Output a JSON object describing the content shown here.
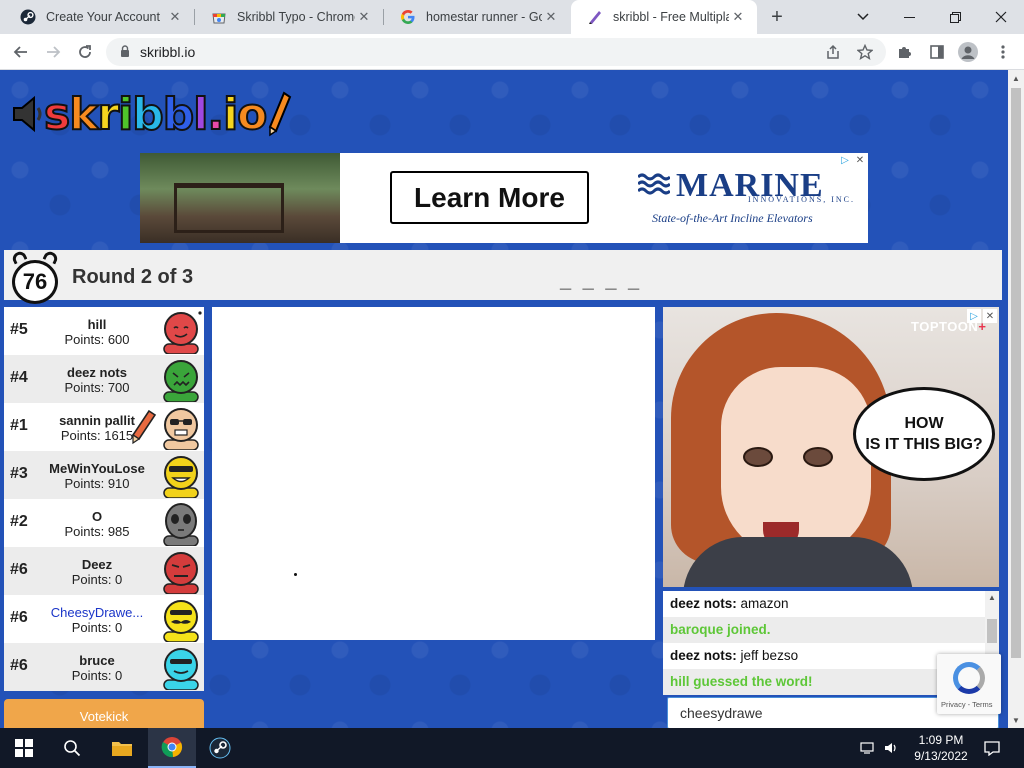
{
  "browser": {
    "tabs": [
      {
        "title": "Create Your Account",
        "icon": "steam-icon"
      },
      {
        "title": "Skribbl Typo - Chrome",
        "icon": "chrome-webstore-icon"
      },
      {
        "title": "homestar runner - Goo",
        "icon": "google-icon"
      },
      {
        "title": "skribbl - Free Multiplay",
        "icon": "skribbl-icon",
        "active": true
      }
    ],
    "url": "skribbl.io"
  },
  "game": {
    "logo_text": "skribbl.io",
    "timer": "76",
    "round_label": "Round 2 of 3",
    "word_hint": "_ _ _ _",
    "players": [
      {
        "rank": "#5",
        "name": "hill",
        "points": "Points: 600",
        "color": "#e04848"
      },
      {
        "rank": "#4",
        "name": "deez nots",
        "points": "Points: 700",
        "color": "#3aa53a"
      },
      {
        "rank": "#1",
        "name": "sannin pallit",
        "points": "Points: 1615",
        "color": "#f0c8a0",
        "drawing": true
      },
      {
        "rank": "#3",
        "name": "MeWinYouLose",
        "points": "Points: 910",
        "color": "#f2d21a"
      },
      {
        "rank": "#2",
        "name": "O",
        "points": "Points: 985",
        "color": "#7a7a7a"
      },
      {
        "rank": "#6",
        "name": "Deez",
        "points": "Points: 0",
        "color": "#d43c3c"
      },
      {
        "rank": "#6",
        "name": "CheesyDrawe...",
        "points": "Points: 0",
        "color": "#f5e21a",
        "me": true
      },
      {
        "rank": "#6",
        "name": "bruce",
        "points": "Points: 0",
        "color": "#3ad4e8"
      }
    ],
    "votekick_label": "Votekick",
    "chat": [
      {
        "who": "deez nots:",
        "text": "amazon"
      },
      {
        "system": "baroque joined."
      },
      {
        "who": "deez nots:",
        "text": "jeff bezso"
      },
      {
        "system": "hill guessed the word!"
      }
    ],
    "chat_input_value": "cheesydrawe"
  },
  "ads": {
    "banner": {
      "cta": "Learn More",
      "brand": "MARINE",
      "brand_sub": "INNOVATIONS, INC.",
      "tagline": "State-of-the-Art Incline Elevators"
    },
    "side": {
      "brand": "TOPTOON",
      "brand_plus": "+",
      "bubble": "HOW\nIS IT THIS BIG?"
    }
  },
  "recaptcha": {
    "label": "Privacy - Terms"
  },
  "taskbar": {
    "time": "1:09 PM",
    "date": "9/13/2022"
  }
}
